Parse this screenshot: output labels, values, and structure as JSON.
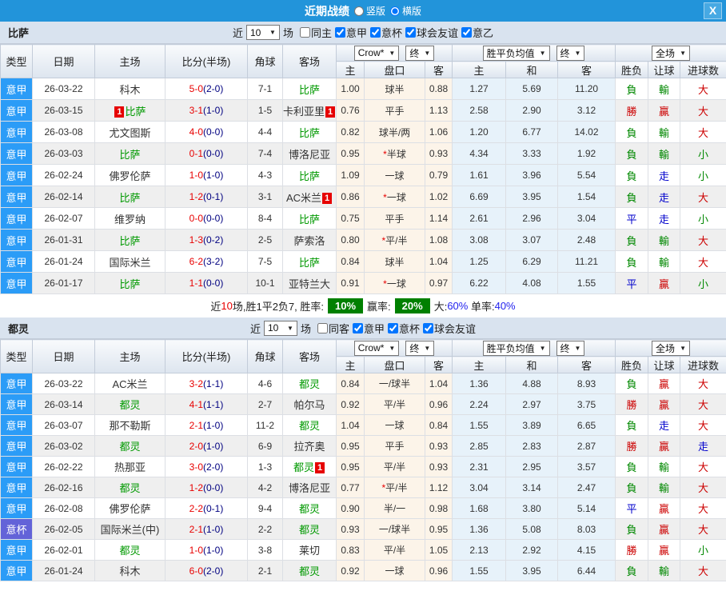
{
  "topbar": {
    "title": "近期战绩",
    "radio_vertical": "竖版",
    "radio_horizontal": "横版",
    "close": "X"
  },
  "filter": {
    "near_label": "近",
    "count": "10",
    "matches_label": "场"
  },
  "headers": {
    "type": "类型",
    "date": "日期",
    "home": "主场",
    "score": "比分(半场)",
    "corner": "角球",
    "away": "客场",
    "crow_select": "Crow*",
    "final_select": "终",
    "avg_select": "胜平负均值",
    "final2_select": "终",
    "full_select": "全场",
    "h": "主",
    "handicap": "盘口",
    "a": "客",
    "h2": "主",
    "d": "和",
    "a2": "客",
    "winloss": "胜负",
    "handicap_result": "让球",
    "goals": "进球数"
  },
  "colors": {
    "accent_blue": "#2294da",
    "league_blue": "#2b9cf7",
    "league_purple": "#6363d8",
    "team_green": "#009900",
    "score_red": "#e80000",
    "half_navy": "#000080",
    "result_green": "#008800",
    "result_red": "#cc0000",
    "result_blue": "#0000cc",
    "rate_badge_green": "#008000",
    "rate_blue": "#2222ee",
    "crow_col_bg": "#fcf4e9",
    "avg_col_bg": "#e7f2fa"
  },
  "sections": [
    {
      "team": "比萨",
      "checkboxes": [
        {
          "label": "同主",
          "checked": false
        },
        {
          "label": "意甲",
          "checked": true
        },
        {
          "label": "意杯",
          "checked": true
        },
        {
          "label": "球会友谊",
          "checked": true
        },
        {
          "label": "意乙",
          "checked": true
        }
      ],
      "rows": [
        {
          "league": "意甲",
          "lc": "b",
          "date": "26-03-22",
          "home": {
            "n": "科木"
          },
          "score": "5-0",
          "half": "(2-0)",
          "corner": "7-1",
          "away": {
            "n": "比萨",
            "g": 1
          },
          "o1": "1.00",
          "hc": "球半",
          "o2": "0.88",
          "a1": "1.27",
          "a2": "5.69",
          "a3": "11.20",
          "r1": [
            "負",
            "g"
          ],
          "r2": [
            "輸",
            "g"
          ],
          "r3": [
            "大",
            "r"
          ]
        },
        {
          "league": "意甲",
          "lc": "b",
          "date": "26-03-15",
          "home": {
            "n": "比萨",
            "g": 1,
            "b": "1",
            "bp": "b"
          },
          "score": "3-1",
          "half": "(1-0)",
          "corner": "1-5",
          "away": {
            "n": "卡利亚里",
            "b": "1",
            "bp": "a"
          },
          "o1": "0.76",
          "hc": "平手",
          "o2": "1.13",
          "a1": "2.58",
          "a2": "2.90",
          "a3": "3.12",
          "r1": [
            "勝",
            "r"
          ],
          "r2": [
            "贏",
            "r"
          ],
          "r3": [
            "大",
            "r"
          ]
        },
        {
          "league": "意甲",
          "lc": "b",
          "date": "26-03-08",
          "home": {
            "n": "尤文图斯"
          },
          "score": "4-0",
          "half": "(0-0)",
          "corner": "4-4",
          "away": {
            "n": "比萨",
            "g": 1
          },
          "o1": "0.82",
          "hc": "球半/两",
          "o2": "1.06",
          "a1": "1.20",
          "a2": "6.77",
          "a3": "14.02",
          "r1": [
            "負",
            "g"
          ],
          "r2": [
            "輸",
            "g"
          ],
          "r3": [
            "大",
            "r"
          ]
        },
        {
          "league": "意甲",
          "lc": "b",
          "date": "26-03-03",
          "home": {
            "n": "比萨",
            "g": 1
          },
          "score": "0-1",
          "half": "(0-0)",
          "corner": "7-4",
          "away": {
            "n": "博洛尼亚"
          },
          "o1": "0.95",
          "hc": "*半球",
          "o2": "0.93",
          "a1": "4.34",
          "a2": "3.33",
          "a3": "1.92",
          "r1": [
            "負",
            "g"
          ],
          "r2": [
            "輸",
            "g"
          ],
          "r3": [
            "小",
            "g"
          ]
        },
        {
          "league": "意甲",
          "lc": "b",
          "date": "26-02-24",
          "home": {
            "n": "佛罗伦萨"
          },
          "score": "1-0",
          "half": "(1-0)",
          "corner": "4-3",
          "away": {
            "n": "比萨",
            "g": 1
          },
          "o1": "1.09",
          "hc": "一球",
          "o2": "0.79",
          "a1": "1.61",
          "a2": "3.96",
          "a3": "5.54",
          "r1": [
            "負",
            "g"
          ],
          "r2": [
            "走",
            "b"
          ],
          "r3": [
            "小",
            "g"
          ]
        },
        {
          "league": "意甲",
          "lc": "b",
          "date": "26-02-14",
          "home": {
            "n": "比萨",
            "g": 1
          },
          "score": "1-2",
          "half": "(0-1)",
          "corner": "3-1",
          "away": {
            "n": "AC米兰",
            "b": "1",
            "bp": "a"
          },
          "o1": "0.86",
          "hc": "*一球",
          "o2": "1.02",
          "a1": "6.69",
          "a2": "3.95",
          "a3": "1.54",
          "r1": [
            "負",
            "g"
          ],
          "r2": [
            "走",
            "b"
          ],
          "r3": [
            "大",
            "r"
          ]
        },
        {
          "league": "意甲",
          "lc": "b",
          "date": "26-02-07",
          "home": {
            "n": "维罗纳"
          },
          "score": "0-0",
          "half": "(0-0)",
          "corner": "8-4",
          "away": {
            "n": "比萨",
            "g": 1
          },
          "o1": "0.75",
          "hc": "平手",
          "o2": "1.14",
          "a1": "2.61",
          "a2": "2.96",
          "a3": "3.04",
          "r1": [
            "平",
            "b"
          ],
          "r2": [
            "走",
            "b"
          ],
          "r3": [
            "小",
            "g"
          ]
        },
        {
          "league": "意甲",
          "lc": "b",
          "date": "26-01-31",
          "home": {
            "n": "比萨",
            "g": 1
          },
          "score": "1-3",
          "half": "(0-2)",
          "corner": "2-5",
          "away": {
            "n": "萨索洛"
          },
          "o1": "0.80",
          "hc": "*平/半",
          "o2": "1.08",
          "a1": "3.08",
          "a2": "3.07",
          "a3": "2.48",
          "r1": [
            "負",
            "g"
          ],
          "r2": [
            "輸",
            "g"
          ],
          "r3": [
            "大",
            "r"
          ]
        },
        {
          "league": "意甲",
          "lc": "b",
          "date": "26-01-24",
          "home": {
            "n": "国际米兰"
          },
          "score": "6-2",
          "half": "(3-2)",
          "corner": "7-5",
          "away": {
            "n": "比萨",
            "g": 1
          },
          "o1": "0.84",
          "hc": "球半",
          "o2": "1.04",
          "a1": "1.25",
          "a2": "6.29",
          "a3": "11.21",
          "r1": [
            "負",
            "g"
          ],
          "r2": [
            "輸",
            "g"
          ],
          "r3": [
            "大",
            "r"
          ]
        },
        {
          "league": "意甲",
          "lc": "b",
          "date": "26-01-17",
          "home": {
            "n": "比萨",
            "g": 1
          },
          "score": "1-1",
          "half": "(0-0)",
          "corner": "10-1",
          "away": {
            "n": "亚特兰大"
          },
          "o1": "0.91",
          "hc": "*一球",
          "o2": "0.97",
          "a1": "6.22",
          "a2": "4.08",
          "a3": "1.55",
          "r1": [
            "平",
            "b"
          ],
          "r2": [
            "贏",
            "r"
          ],
          "r3": [
            "小",
            "g"
          ]
        }
      ],
      "summary": {
        "p1": "近",
        "n": "10",
        "p2": "场,胜1平2负7, 胜率:",
        "win_rate": "10%",
        "p3": "赢率:",
        "odds_rate": "20%",
        "p4": "大:",
        "big": "60%",
        "p5": "单率:",
        "single": "40%"
      }
    },
    {
      "team": "都灵",
      "checkboxes": [
        {
          "label": "同客",
          "checked": false
        },
        {
          "label": "意甲",
          "checked": true
        },
        {
          "label": "意杯",
          "checked": true
        },
        {
          "label": "球会友谊",
          "checked": true
        }
      ],
      "rows": [
        {
          "league": "意甲",
          "lc": "b",
          "date": "26-03-22",
          "home": {
            "n": "AC米兰"
          },
          "score": "3-2",
          "half": "(1-1)",
          "corner": "4-6",
          "away": {
            "n": "都灵",
            "g": 1
          },
          "o1": "0.84",
          "hc": "一/球半",
          "o2": "1.04",
          "a1": "1.36",
          "a2": "4.88",
          "a3": "8.93",
          "r1": [
            "負",
            "g"
          ],
          "r2": [
            "贏",
            "r"
          ],
          "r3": [
            "大",
            "r"
          ]
        },
        {
          "league": "意甲",
          "lc": "b",
          "date": "26-03-14",
          "home": {
            "n": "都灵",
            "g": 1
          },
          "score": "4-1",
          "half": "(1-1)",
          "corner": "2-7",
          "away": {
            "n": "帕尔马"
          },
          "o1": "0.92",
          "hc": "平/半",
          "o2": "0.96",
          "a1": "2.24",
          "a2": "2.97",
          "a3": "3.75",
          "r1": [
            "勝",
            "r"
          ],
          "r2": [
            "贏",
            "r"
          ],
          "r3": [
            "大",
            "r"
          ]
        },
        {
          "league": "意甲",
          "lc": "b",
          "date": "26-03-07",
          "home": {
            "n": "那不勒斯"
          },
          "score": "2-1",
          "half": "(1-0)",
          "corner": "11-2",
          "away": {
            "n": "都灵",
            "g": 1
          },
          "o1": "1.04",
          "hc": "一球",
          "o2": "0.84",
          "a1": "1.55",
          "a2": "3.89",
          "a3": "6.65",
          "r1": [
            "負",
            "g"
          ],
          "r2": [
            "走",
            "b"
          ],
          "r3": [
            "大",
            "r"
          ]
        },
        {
          "league": "意甲",
          "lc": "b",
          "date": "26-03-02",
          "home": {
            "n": "都灵",
            "g": 1
          },
          "score": "2-0",
          "half": "(1-0)",
          "corner": "6-9",
          "away": {
            "n": "拉齐奥"
          },
          "o1": "0.95",
          "hc": "平手",
          "o2": "0.93",
          "a1": "2.85",
          "a2": "2.83",
          "a3": "2.87",
          "r1": [
            "勝",
            "r"
          ],
          "r2": [
            "贏",
            "r"
          ],
          "r3": [
            "走",
            "b"
          ]
        },
        {
          "league": "意甲",
          "lc": "b",
          "date": "26-02-22",
          "home": {
            "n": "热那亚"
          },
          "score": "3-0",
          "half": "(2-0)",
          "corner": "1-3",
          "away": {
            "n": "都灵",
            "g": 1,
            "b": "1",
            "bp": "a"
          },
          "o1": "0.95",
          "hc": "平/半",
          "o2": "0.93",
          "a1": "2.31",
          "a2": "2.95",
          "a3": "3.57",
          "r1": [
            "負",
            "g"
          ],
          "r2": [
            "輸",
            "g"
          ],
          "r3": [
            "大",
            "r"
          ]
        },
        {
          "league": "意甲",
          "lc": "b",
          "date": "26-02-16",
          "home": {
            "n": "都灵",
            "g": 1
          },
          "score": "1-2",
          "half": "(0-0)",
          "corner": "4-2",
          "away": {
            "n": "博洛尼亚"
          },
          "o1": "0.77",
          "hc": "*平/半",
          "o2": "1.12",
          "a1": "3.04",
          "a2": "3.14",
          "a3": "2.47",
          "r1": [
            "負",
            "g"
          ],
          "r2": [
            "輸",
            "g"
          ],
          "r3": [
            "大",
            "r"
          ]
        },
        {
          "league": "意甲",
          "lc": "b",
          "date": "26-02-08",
          "home": {
            "n": "佛罗伦萨"
          },
          "score": "2-2",
          "half": "(0-1)",
          "corner": "9-4",
          "away": {
            "n": "都灵",
            "g": 1
          },
          "o1": "0.90",
          "hc": "半/一",
          "o2": "0.98",
          "a1": "1.68",
          "a2": "3.80",
          "a3": "5.14",
          "r1": [
            "平",
            "b"
          ],
          "r2": [
            "贏",
            "r"
          ],
          "r3": [
            "大",
            "r"
          ]
        },
        {
          "league": "意杯",
          "lc": "p",
          "date": "26-02-05",
          "home": {
            "n": "国际米兰(中)"
          },
          "score": "2-1",
          "half": "(1-0)",
          "corner": "2-2",
          "away": {
            "n": "都灵",
            "g": 1
          },
          "o1": "0.93",
          "hc": "一/球半",
          "o2": "0.95",
          "a1": "1.36",
          "a2": "5.08",
          "a3": "8.03",
          "r1": [
            "負",
            "g"
          ],
          "r2": [
            "贏",
            "r"
          ],
          "r3": [
            "大",
            "r"
          ]
        },
        {
          "league": "意甲",
          "lc": "b",
          "date": "26-02-01",
          "home": {
            "n": "都灵",
            "g": 1
          },
          "score": "1-0",
          "half": "(1-0)",
          "corner": "3-8",
          "away": {
            "n": "莱切"
          },
          "o1": "0.83",
          "hc": "平/半",
          "o2": "1.05",
          "a1": "2.13",
          "a2": "2.92",
          "a3": "4.15",
          "r1": [
            "勝",
            "r"
          ],
          "r2": [
            "贏",
            "r"
          ],
          "r3": [
            "小",
            "g"
          ]
        },
        {
          "league": "意甲",
          "lc": "b",
          "date": "26-01-24",
          "home": {
            "n": "科木"
          },
          "score": "6-0",
          "half": "(2-0)",
          "corner": "2-1",
          "away": {
            "n": "都灵",
            "g": 1
          },
          "o1": "0.92",
          "hc": "一球",
          "o2": "0.96",
          "a1": "1.55",
          "a2": "3.95",
          "a3": "6.44",
          "r1": [
            "負",
            "g"
          ],
          "r2": [
            "輸",
            "g"
          ],
          "r3": [
            "大",
            "r"
          ]
        }
      ]
    }
  ]
}
